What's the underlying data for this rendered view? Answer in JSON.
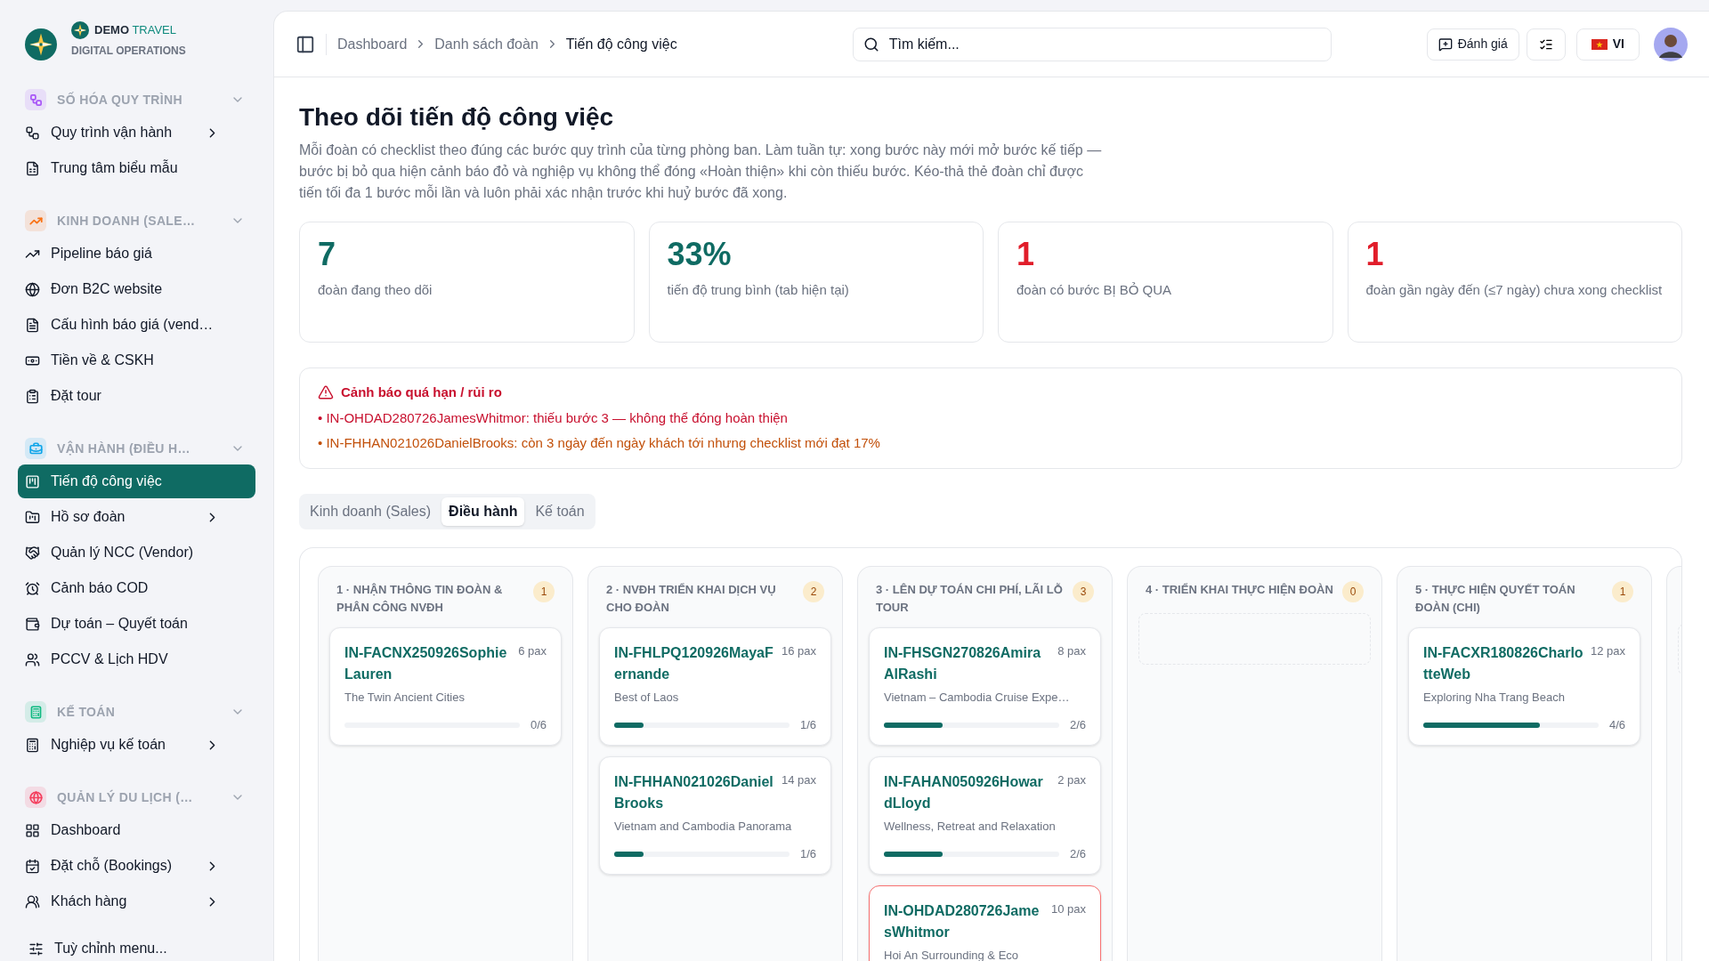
{
  "brand": {
    "name_bold": "DEMO",
    "name_light": "TRAVEL",
    "subtitle": "DIGITAL OPERATIONS"
  },
  "sidebar": {
    "sections": [
      {
        "title": "SỐ HÓA QUY TRÌNH",
        "color": "#a855f7",
        "expanded": true,
        "items": [
          {
            "label": "Quy trình vận hành",
            "has_submenu": true,
            "selected": false
          },
          {
            "label": "Trung tâm biểu mẫu",
            "has_submenu": false,
            "selected": false
          }
        ]
      },
      {
        "title": "KINH DOANH (SALE…",
        "color": "#f97316",
        "expanded": true,
        "items": [
          {
            "label": "Pipeline báo giá",
            "has_submenu": false,
            "selected": false
          },
          {
            "label": "Đơn B2C website",
            "has_submenu": false,
            "selected": false
          },
          {
            "label": "Cấu hình báo giá (vend…",
            "has_submenu": false,
            "selected": false
          },
          {
            "label": "Tiền về & CSKH",
            "has_submenu": false,
            "selected": false
          },
          {
            "label": "Đặt tour",
            "has_submenu": false,
            "selected": false
          }
        ]
      },
      {
        "title": "VẬN HÀNH (ĐIỀU H…",
        "color": "#0ea5e9",
        "expanded": true,
        "items": [
          {
            "label": "Tiến độ công việc",
            "has_submenu": false,
            "selected": true
          },
          {
            "label": "Hồ sơ đoàn",
            "has_submenu": true,
            "selected": false
          },
          {
            "label": "Quản lý NCC (Vendor)",
            "has_submenu": false,
            "selected": false
          },
          {
            "label": "Cảnh báo COD",
            "has_submenu": false,
            "selected": false
          },
          {
            "label": "Dự toán – Quyết toán",
            "has_submenu": false,
            "selected": false
          },
          {
            "label": "PCCV & Lịch HDV",
            "has_submenu": false,
            "selected": false
          }
        ]
      },
      {
        "title": "KẾ TOÁN",
        "color": "#10b981",
        "expanded": true,
        "items": [
          {
            "label": "Nghiệp vụ kế toán",
            "has_submenu": true,
            "selected": false
          }
        ]
      },
      {
        "title": "QUẢN LÝ DU LỊCH (…",
        "color": "#f43f5e",
        "expanded": true,
        "items": [
          {
            "label": "Dashboard",
            "has_submenu": false,
            "selected": false
          },
          {
            "label": "Đặt chỗ (Bookings)",
            "has_submenu": true,
            "selected": false
          },
          {
            "label": "Khách hàng",
            "has_submenu": true,
            "selected": false
          }
        ]
      }
    ],
    "customize": "Tuỳ chỉnh menu..."
  },
  "breadcrumbs": [
    "Dashboard",
    "Danh sách đoàn",
    "Tiến độ công việc"
  ],
  "search": {
    "placeholder": "Tìm kiếm..."
  },
  "header_buttons": {
    "feedback": "Đánh giá",
    "language": "VI"
  },
  "page": {
    "title": "Theo dõi tiến độ công việc",
    "description": "Mỗi đoàn có checklist theo đúng các bước quy trình của từng phòng ban. Làm tuần tự: xong bước này mới mở bước kế tiếp — bước bị bỏ qua hiện cảnh báo đỏ và nghiệp vụ không thể đóng «Hoàn thiện» khi còn thiếu bước. Kéo-thả thẻ đoàn chỉ được tiến tối đa 1 bước mỗi lần và luôn phải xác nhận trước khi huỷ bước đã xong."
  },
  "stats": [
    {
      "value": "7",
      "label": "đoàn đang theo dõi",
      "color": "#0f6b63"
    },
    {
      "value": "33%",
      "label": "tiến độ trung bình (tab hiện tại)",
      "color": "#0f6b63"
    },
    {
      "value": "1",
      "label": "đoàn có bước BỊ BỎ QUA",
      "color": "#e11d2a"
    },
    {
      "value": "1",
      "label": "đoàn gần ngày đến (≤7 ngày) chưa xong checklist",
      "color": "#e11d2a"
    }
  ],
  "alert": {
    "title": "Cảnh báo quá hạn / rủi ro",
    "lines": [
      {
        "text": "• IN-OHDAD280726JamesWhitmor: thiếu bước 3 — không thể đóng hoàn thiện",
        "color": "#c8102e"
      },
      {
        "text": "• IN-FHHAN021026DanielBrooks: còn 3 ngày đến ngày khách tới nhưng checklist mới đạt 17%",
        "color": "#c2500a"
      }
    ]
  },
  "tabs": [
    {
      "label": "Kinh doanh (Sales)",
      "selected": false
    },
    {
      "label": "Điều hành",
      "selected": true
    },
    {
      "label": "Kế toán",
      "selected": false
    }
  ],
  "columns": [
    {
      "title": "1 · NHẬN THÔNG TIN ĐOÀN & PHÂN CÔNG NVĐH",
      "count": "1",
      "cards": [
        {
          "code": "IN-FACNX250926SophieLauren",
          "pax": "6 pax",
          "tour": "The Twin Ancient Cities",
          "level": 0,
          "progress": "0/6",
          "overdue": false
        }
      ]
    },
    {
      "title": "2 · NVĐH TRIỂN KHAI DỊCH VỤ CHO ĐOÀN",
      "count": "2",
      "cards": [
        {
          "code": "IN-FHLPQ120926MayaFernande",
          "pax": "16 pax",
          "tour": "Best of Laos",
          "level": 0.167,
          "progress": "1/6",
          "overdue": false
        },
        {
          "code": "IN-FHHAN021026DanielBrooks",
          "pax": "14 pax",
          "tour": "Vietnam and Cambodia Panorama",
          "level": 0.167,
          "progress": "1/6",
          "overdue": false
        }
      ]
    },
    {
      "title": "3 · LÊN DỰ TOÁN CHI PHÍ, LÃI LỖ TOUR",
      "count": "3",
      "cards": [
        {
          "code": "IN-FHSGN270826AmiraAlRashi",
          "pax": "8 pax",
          "tour": "Vietnam – Cambodia Cruise Expe…",
          "level": 0.333,
          "progress": "2/6",
          "overdue": false
        },
        {
          "code": "IN-FAHAN050926HowardLloyd",
          "pax": "2 pax",
          "tour": "Wellness, Retreat and Relaxation",
          "level": 0.333,
          "progress": "2/6",
          "overdue": false
        },
        {
          "code": "IN-OHDAD280726JamesWhitmor",
          "pax": "10 pax",
          "tour": "Hoi An Surrounding & Eco",
          "overdue": true
        }
      ]
    },
    {
      "title": "4 · TRIỂN KHAI THỰC HIỆN ĐOÀN",
      "count": "0"
    },
    {
      "title": "5 · THỰC HIỆN QUYẾT TOÁN ĐOÀN (CHI)",
      "count": "1",
      "cards": [
        {
          "code": "IN-FACXR180826CharlotteWeb",
          "pax": "12 pax",
          "tour": "Exploring Nha Trang Beach",
          "level": 0.667,
          "progress": "4/6",
          "overdue": false
        }
      ]
    }
  ]
}
